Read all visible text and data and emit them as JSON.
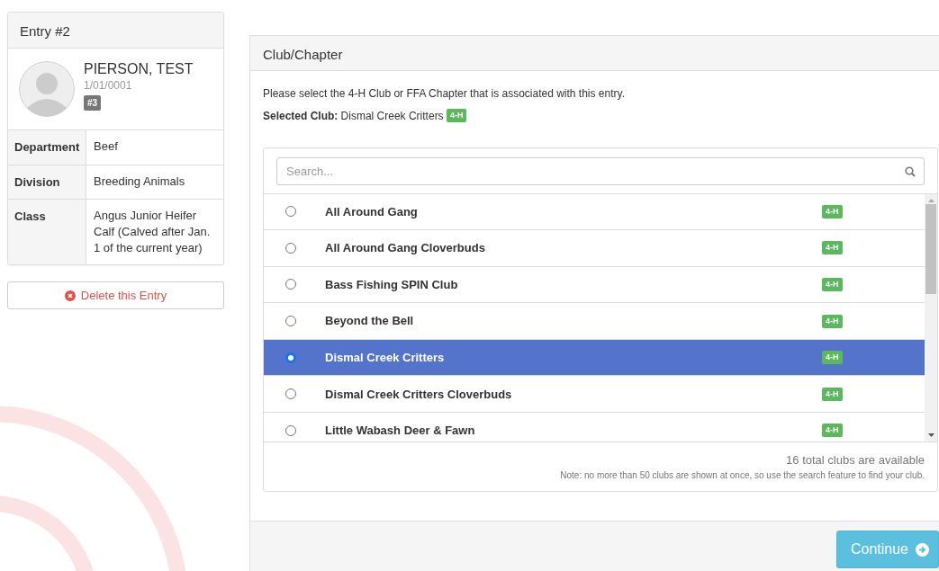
{
  "entry": {
    "title": "Entry #2",
    "name": "PIERSON, TEST",
    "date": "1/01/0001",
    "number": "#3",
    "details": [
      {
        "label": "Department",
        "value": "Beef"
      },
      {
        "label": "Division",
        "value": "Breeding Animals"
      },
      {
        "label": "Class",
        "value": "Angus Junior Heifer Calf (Calved after Jan. 1 of the current year)"
      }
    ],
    "delete_button": "Delete this Entry"
  },
  "club_panel": {
    "title": "Club/Chapter",
    "instructions": "Please select the 4-H Club or FFA Chapter that is associated with this entry.",
    "selected_label": "Selected Club:",
    "selected_name": "Dismal Creek Critters",
    "selected_tag": "4-H",
    "search": {
      "placeholder": "Search..."
    },
    "clubs": [
      {
        "name": "All Around Gang",
        "tag": "4-H",
        "selected": false
      },
      {
        "name": "All Around Gang Cloverbuds",
        "tag": "4-H",
        "selected": false
      },
      {
        "name": "Bass Fishing SPIN Club",
        "tag": "4-H",
        "selected": false
      },
      {
        "name": "Beyond the Bell",
        "tag": "4-H",
        "selected": false
      },
      {
        "name": "Dismal Creek Critters",
        "tag": "4-H",
        "selected": true
      },
      {
        "name": "Dismal Creek Critters Cloverbuds",
        "tag": "4-H",
        "selected": false
      },
      {
        "name": "Little Wabash Deer & Fawn",
        "tag": "4-H",
        "selected": false
      }
    ],
    "total": "16 total clubs are available",
    "note": "Note: no more than 50 clubs are shown at once, so use the search feature to find your club.",
    "continue_button": "Continue"
  }
}
